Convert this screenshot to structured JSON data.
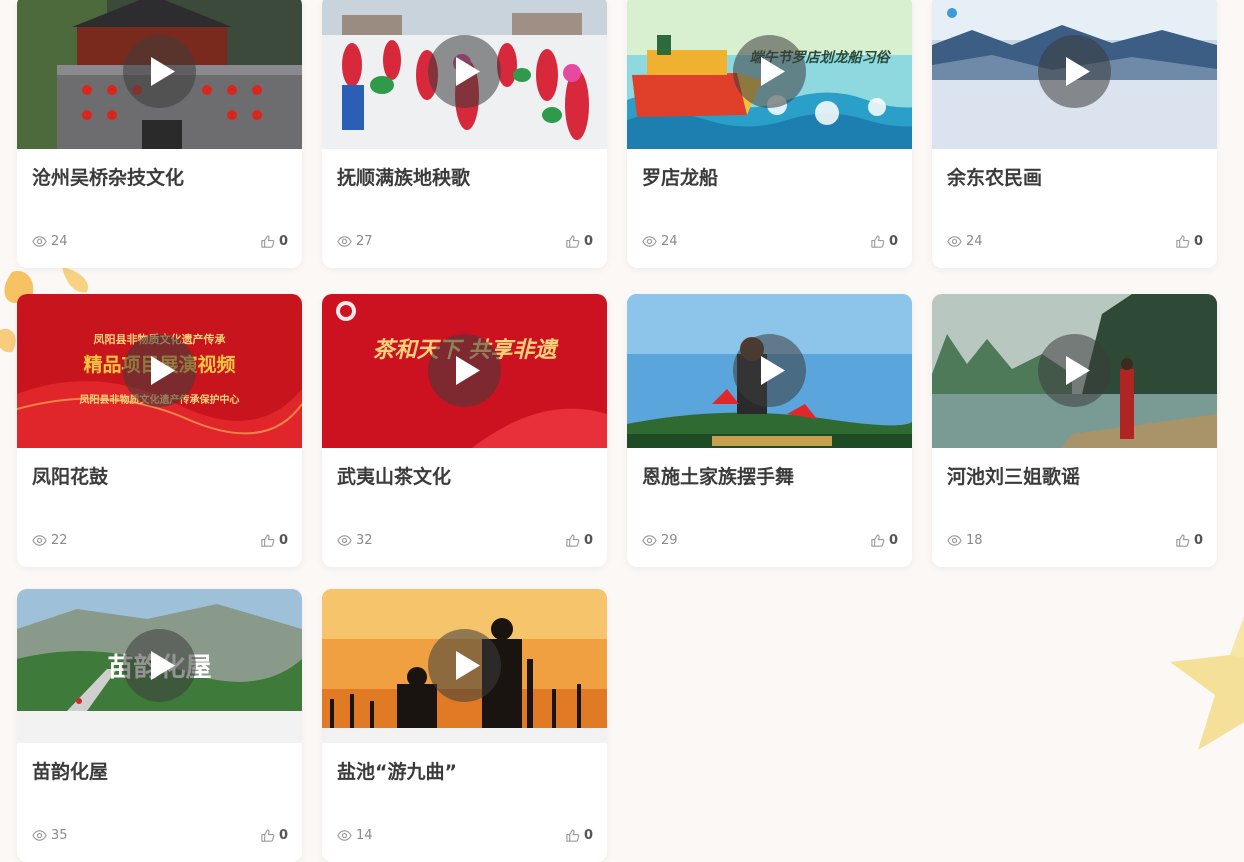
{
  "colors": {
    "page_background": "#fbf8f6",
    "card_background": "#ffffff",
    "title_text": "#3b3b3b",
    "meta_text": "#8a8a8a"
  },
  "icons": {
    "views": "eye-icon",
    "likes": "thumbs-up-icon",
    "play": "play-icon"
  },
  "cards": [
    {
      "title": "沧州吴桥杂技文化",
      "views": "24",
      "likes": "0",
      "thumb_overlay": ""
    },
    {
      "title": "抚顺满族地秧歌",
      "views": "27",
      "likes": "0",
      "thumb_overlay": ""
    },
    {
      "title": "罗店龙船",
      "views": "24",
      "likes": "0",
      "thumb_overlay": "端午节罗店划龙船习俗"
    },
    {
      "title": "余东农民画",
      "views": "24",
      "likes": "0",
      "thumb_overlay": ""
    },
    {
      "title": "凤阳花鼓",
      "views": "22",
      "likes": "0",
      "thumb_overlay": "精品项目展演视频",
      "thumb_overlay_top": "凤阳县非物质文化遗产传承",
      "thumb_overlay_bottom": "凤阳县非物质文化遗产传承保护中心"
    },
    {
      "title": "武夷山茶文化",
      "views": "32",
      "likes": "0",
      "thumb_overlay": "茶和天下 共享非遗"
    },
    {
      "title": "恩施土家族摆手舞",
      "views": "29",
      "likes": "0",
      "thumb_overlay": ""
    },
    {
      "title": "河池刘三姐歌谣",
      "views": "18",
      "likes": "0",
      "thumb_overlay": ""
    },
    {
      "title": "苗韵化屋",
      "views": "35",
      "likes": "0",
      "thumb_overlay": "苗韵化屋"
    },
    {
      "title": "盐池“游九曲”",
      "views": "14",
      "likes": "0",
      "thumb_overlay": ""
    }
  ]
}
